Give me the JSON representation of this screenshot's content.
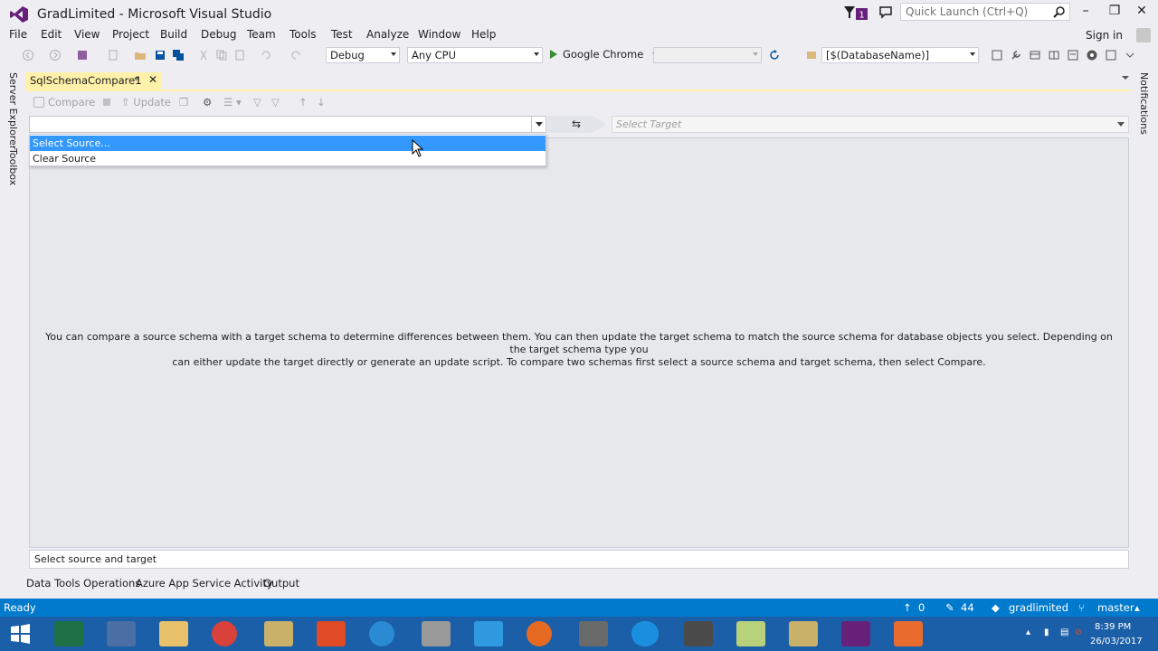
{
  "window": {
    "title": "GradLimited - Microsoft Visual Studio",
    "notification_count": "1",
    "quick_launch_placeholder": "Quick Launch (Ctrl+Q)"
  },
  "menu": {
    "items": [
      "File",
      "Edit",
      "View",
      "Project",
      "Build",
      "Debug",
      "Team",
      "Tools",
      "Test",
      "Analyze",
      "Window",
      "Help"
    ],
    "sign_in": "Sign in"
  },
  "toolbar": {
    "config": "Debug",
    "platform": "Any CPU",
    "run_target": "Google Chrome",
    "database": "[$(DatabaseName)]"
  },
  "side_tabs": {
    "left": [
      "Server Explorer",
      "Toolbox"
    ],
    "right": [
      "Notifications"
    ]
  },
  "document": {
    "tab_title": "SqlSchemaCompare1",
    "compare_label": "Compare",
    "update_label": "Update",
    "target_placeholder": "Select Target",
    "dropdown": [
      "Select Source...",
      "Clear Source"
    ],
    "info_line1": "You can compare a source schema with a target schema to determine differences between them.  You can then update the target schema to match the source schema for database objects you select.  Depending on the target schema type you",
    "info_line2": "can either update the target directly or generate an update script.  To compare two schemas first select a source schema and target schema, then select Compare.",
    "status_text": "Select source and target"
  },
  "bottom_tabs": [
    "Data Tools Operations",
    "Azure App Service Activity",
    "Output"
  ],
  "statusbar": {
    "ready": "Ready",
    "up_count": "0",
    "pencil_count": "44",
    "repo": "gradlimited",
    "branch": "master"
  },
  "taskbar": {
    "time": "8:39 PM",
    "date": "26/03/2017"
  },
  "colors": {
    "accent": "#007acc",
    "tab_active": "#fff1a9",
    "selection": "#3399ff",
    "taskbar": "#1b5fa8"
  }
}
